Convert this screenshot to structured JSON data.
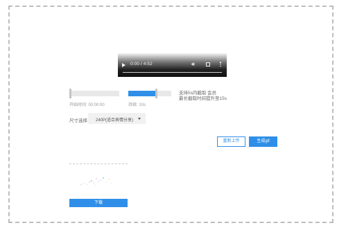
{
  "video": {
    "time_display": "0:00 / 4:52",
    "icons": [
      "play-icon",
      "volume-icon",
      "fullscreen-icon",
      "more-options-icon"
    ]
  },
  "trim": {
    "start_label": "开始时间: 00:00:00",
    "duration_label": "持续: 10s",
    "duration_fill": 0.65
  },
  "notice": {
    "line1": "支持5s内截取 会员",
    "line2": "最长截取时间提升至15s"
  },
  "size": {
    "label": "尺寸选择",
    "selected": "240P(适合表情分享)"
  },
  "buttons": {
    "reupload": "重新上传",
    "generate": "生成gif",
    "download": "下载"
  },
  "colors": {
    "accent": "#2f8fe8",
    "border_dashed": "#bdbdbd"
  }
}
